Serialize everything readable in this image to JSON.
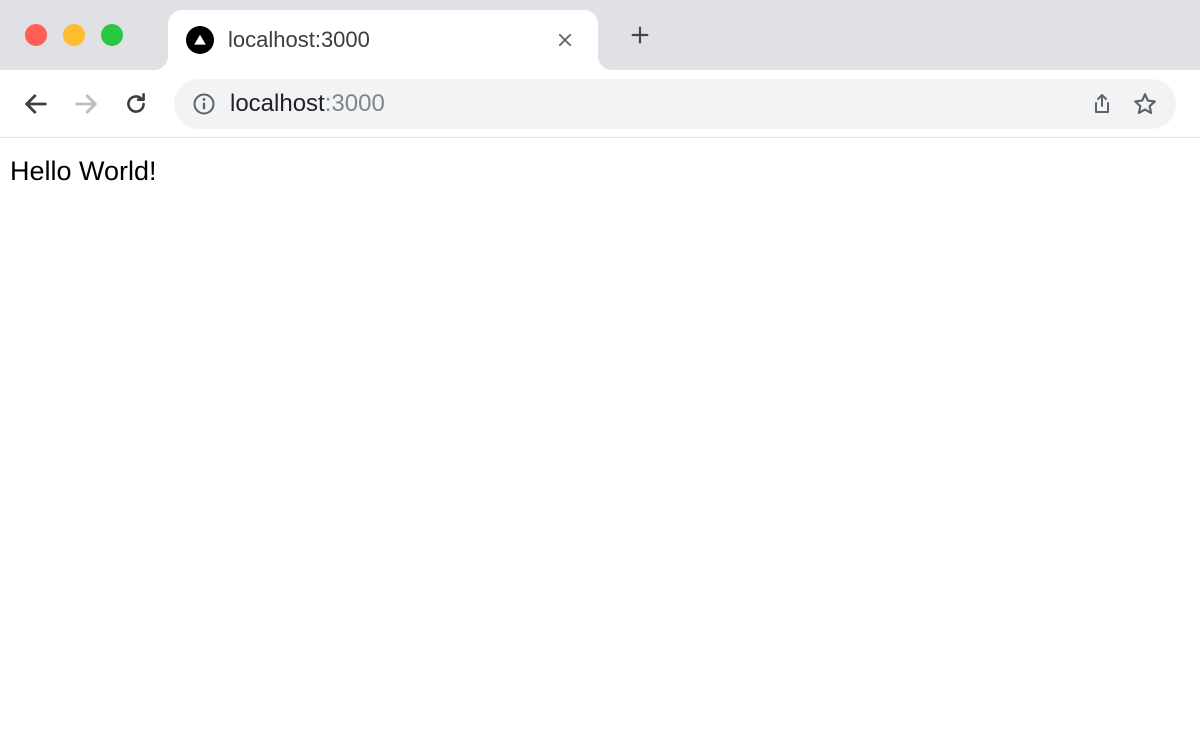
{
  "window": {
    "traffic_lights": [
      "close",
      "minimize",
      "maximize"
    ]
  },
  "tab": {
    "title": "localhost:3000",
    "favicon": "vercel-triangle-icon"
  },
  "toolbar": {
    "back": "Back",
    "forward": "Forward",
    "reload": "Reload"
  },
  "address_bar": {
    "scheme_icon": "info",
    "host": "localhost",
    "port": ":3000",
    "actions": [
      "share",
      "bookmark"
    ]
  },
  "page": {
    "body_text": "Hello World!"
  }
}
